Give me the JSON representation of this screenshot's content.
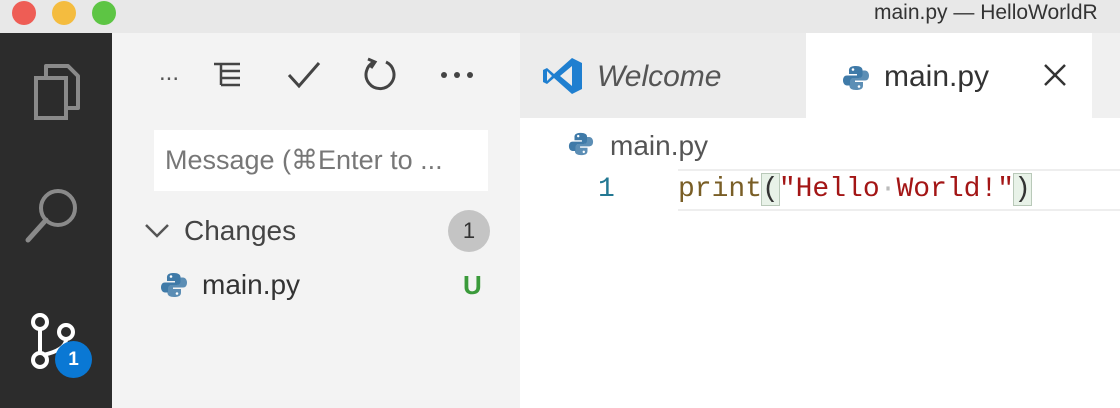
{
  "window": {
    "title": "main.py — HelloWorldR",
    "traffic_colors": [
      "#ee5d55",
      "#f4bc3f",
      "#5dc544"
    ]
  },
  "activity_bar": {
    "icons": [
      "files-icon",
      "search-icon",
      "source-control-icon"
    ],
    "scm_badge": "1"
  },
  "scm": {
    "toolbar": {
      "overflow_left": "...",
      "icons": [
        "view-as-tree-icon",
        "commit-check-icon",
        "refresh-icon",
        "more-actions-icon"
      ]
    },
    "commit_placeholder": "Message (⌘Enter to ...",
    "changes": {
      "label": "Changes",
      "count": "1",
      "files": [
        {
          "name": "main.py",
          "status": "U",
          "status_color": "#3a9a3a"
        }
      ]
    }
  },
  "editor": {
    "tabs": [
      {
        "label": "Welcome",
        "active": false
      },
      {
        "label": "main.py",
        "active": true
      }
    ],
    "breadcrumb": "main.py",
    "lines": [
      {
        "number": "1",
        "fn": "print",
        "open": "(",
        "str1": "\"Hello",
        "str2": "World!\"",
        "close": ")"
      }
    ]
  }
}
